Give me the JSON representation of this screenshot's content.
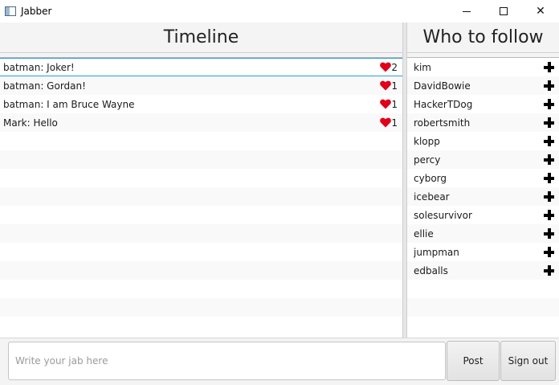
{
  "window": {
    "title": "Jabber",
    "icon": "app-window-icon"
  },
  "timeline": {
    "header": "Timeline",
    "items": [
      {
        "text": "batman: Joker!",
        "likes": "2"
      },
      {
        "text": "batman: Gordan!",
        "likes": "1"
      },
      {
        "text": "batman: I am Bruce Wayne",
        "likes": "1"
      },
      {
        "text": "Mark: Hello",
        "likes": "1"
      }
    ],
    "selected_index": 0,
    "like_icon": "heart-icon",
    "like_color": "#e0001a"
  },
  "who_to_follow": {
    "header": "Who to follow",
    "users": [
      "kim",
      "DavidBowie",
      "HackerTDog",
      "robertsmith",
      "klopp",
      "percy",
      "cyborg",
      "icebear",
      "solesurvivor",
      "ellie",
      "jumpman",
      "edballs"
    ],
    "follow_icon": "plus-icon"
  },
  "composer": {
    "placeholder": "Write your jab here",
    "value": "",
    "post_label": "Post",
    "signout_label": "Sign out"
  },
  "colors": {
    "selection": "#2a9fd6"
  }
}
